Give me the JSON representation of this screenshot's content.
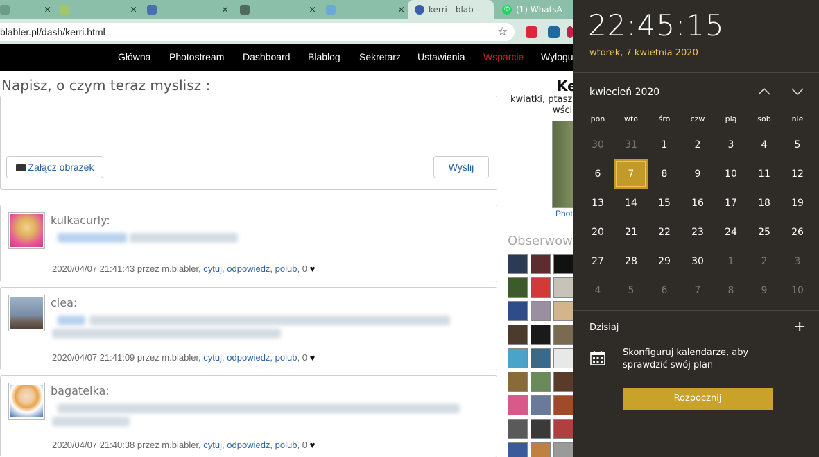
{
  "browser": {
    "tabs": [
      {
        "title": "(1) WhatsA",
        "active": false,
        "favicon": "whatsapp-icon"
      },
      {
        "title": "kerri - blab",
        "active": true,
        "favicon": "globe-icon"
      }
    ],
    "tab_close": "×",
    "url": "blabler.pl/dash/kerri.html",
    "bookmark_icon": "☆"
  },
  "sitenav": {
    "items": [
      "Główna",
      "Photostream",
      "Dashboard",
      "Blablog",
      "Sekretarz",
      "Ustawienia",
      "Wsparcie",
      "Wylogu"
    ],
    "highlight_color": "#d21f26"
  },
  "compose": {
    "heading": "Napisz, o czym teraz myslisz :",
    "attach_label": "Załącz obrazek",
    "send_label": "Wyślij"
  },
  "posts": [
    {
      "author": "kulkacurly:",
      "date": "2020/04/07 21:41:43",
      "by": "przez m.blabler,",
      "quote": "cytuj",
      "reply": "odpowiedz",
      "like": "polub",
      "count": "0",
      "heart": "♥"
    },
    {
      "author": "clea:",
      "date": "2020/04/07 21:41:09",
      "by": "przez m.blabler,",
      "quote": "cytuj",
      "reply": "odpowiedz",
      "like": "polub",
      "count": "0",
      "heart": "♥"
    },
    {
      "author": "bagatelka:",
      "date": "2020/04/07 21:40:38",
      "by": "przez m.blabler,",
      "quote": "cytuj",
      "reply": "odpowiedz",
      "like": "polub",
      "count": "0",
      "heart": "♥"
    }
  ],
  "sidebar": {
    "profile_name": "Ke",
    "desc_line1": "kwiatki, ptasz",
    "desc_line2": "wści",
    "photo_link": "Phot",
    "following_heading": "Obserwow"
  },
  "flyout": {
    "time": "22:45:15",
    "date": "wtorek, 7 kwietnia 2020",
    "month": "kwiecień 2020",
    "up_icon": "chevron-up-icon",
    "down_icon": "chevron-down-icon",
    "weekdays": [
      "pon",
      "wto",
      "śro",
      "czw",
      "pią",
      "sob",
      "nie"
    ],
    "weeks": [
      [
        "30",
        "31",
        "1",
        "2",
        "3",
        "4",
        "5"
      ],
      [
        "6",
        "7",
        "8",
        "9",
        "10",
        "11",
        "12"
      ],
      [
        "13",
        "14",
        "15",
        "16",
        "17",
        "18",
        "19"
      ],
      [
        "20",
        "21",
        "22",
        "23",
        "24",
        "25",
        "26"
      ],
      [
        "27",
        "28",
        "29",
        "30",
        "1",
        "2",
        "3"
      ],
      [
        "4",
        "5",
        "6",
        "7",
        "8",
        "9",
        "10"
      ]
    ],
    "today_label": "Dzisiaj",
    "add_icon": "+",
    "calendar_message": "Skonfiguruj kalendarze, aby sprawdzić swój plan",
    "start_button": "Rozpocznij",
    "accent": "#c9a229"
  }
}
